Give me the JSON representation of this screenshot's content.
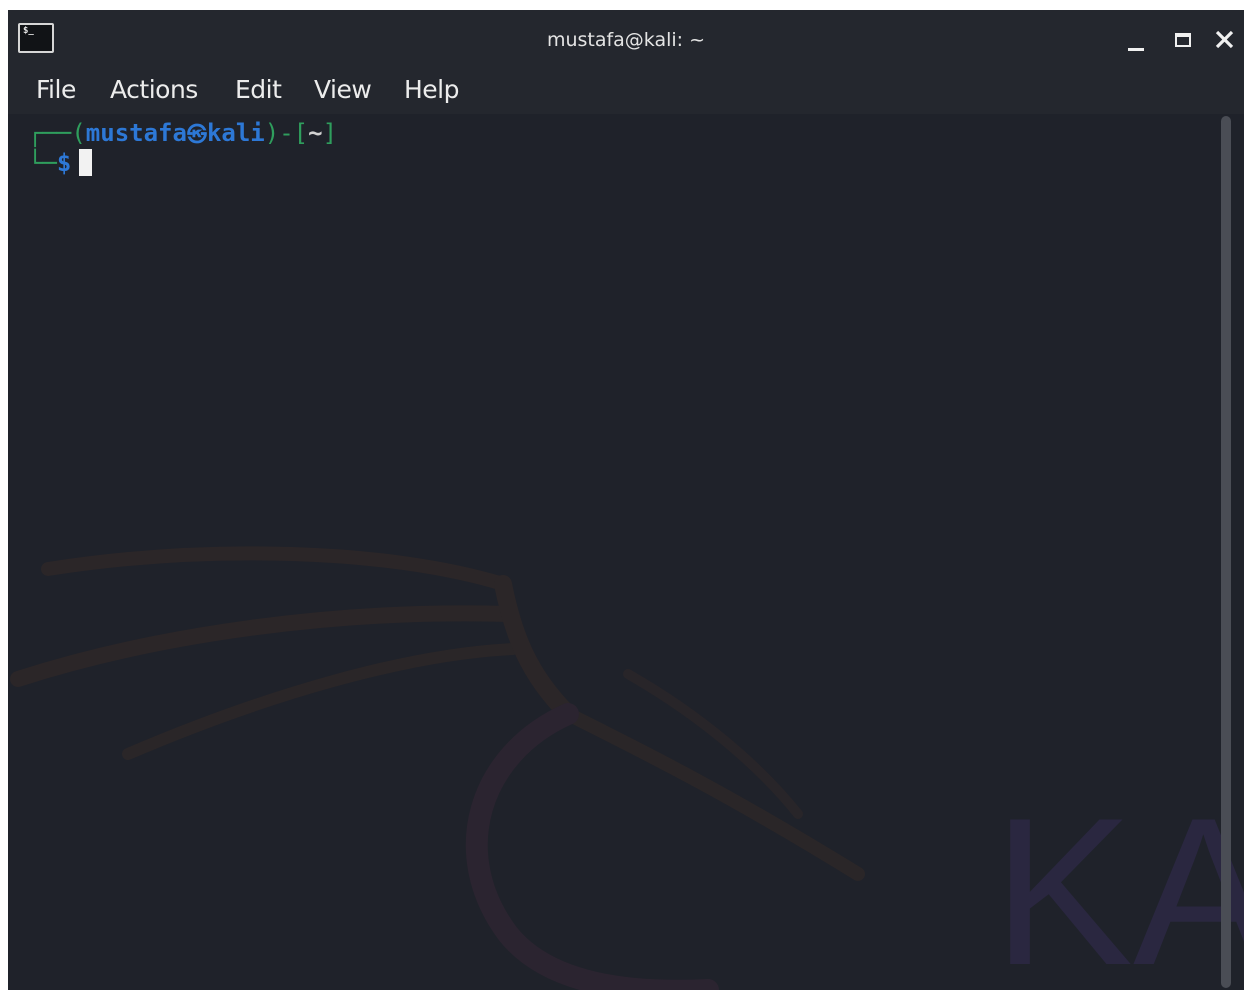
{
  "window": {
    "title": "mustafa@kali: ~",
    "app_icon": "terminal-icon",
    "app_icon_glyph": "$_"
  },
  "controls": {
    "minimize_icon": "minimize-icon",
    "maximize_icon": "maximize-icon",
    "close_icon": "close-icon"
  },
  "menu": {
    "items": [
      "File",
      "Actions",
      "Edit",
      "View",
      "Help"
    ]
  },
  "terminal": {
    "frame_top": "┌──(",
    "user": "mustafa",
    "at_symbol": "㉿",
    "host": "kali",
    "mid": ")-[",
    "dir": "~",
    "end": "]",
    "frame_bottom": "└─",
    "prompt": "$"
  },
  "background_watermark": {
    "logo": "kali-dragon-logo",
    "text": "KA"
  },
  "colors": {
    "background": "#1f222a",
    "titlebar": "#24272e",
    "prompt_blue": "#2d78d6",
    "frame_green": "#2f9e5d",
    "watermark_text": "#2c2840",
    "dragon": "#2d2628"
  }
}
